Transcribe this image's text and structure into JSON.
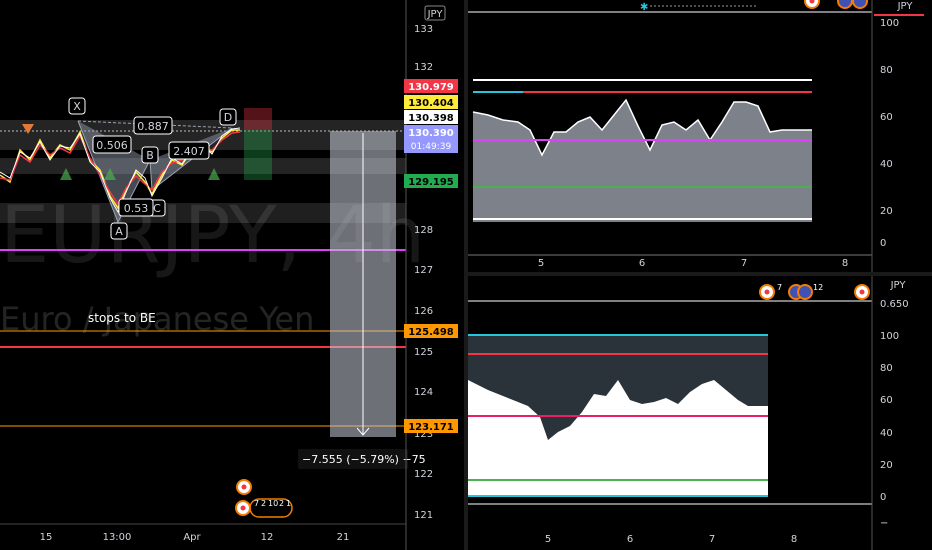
{
  "main_chart": {
    "currency": "JPY",
    "watermark_symbol": "EURJPY, 4h",
    "watermark_desc": "Euro / Japanese Yen",
    "annotation": "stops to BE",
    "measure_label": "−7.555 (−5.79%) −75",
    "pattern_points": [
      "X",
      "A",
      "B",
      "C",
      "D"
    ],
    "pattern_ratios": [
      "0.887",
      "0.506",
      "0.53",
      "2.407"
    ],
    "price_ticks": [
      "133",
      "132",
      "128",
      "127",
      "126",
      "125",
      "124",
      "123",
      "122",
      "121"
    ],
    "time_ticks": [
      "15",
      "13:00",
      "Apr",
      "12",
      "21"
    ],
    "price_badges": [
      {
        "label": "130.979",
        "color": "#f23645"
      },
      {
        "label": "130.404",
        "color": "#ffeb3b"
      },
      {
        "label": "130.398",
        "color": "#ffffff"
      },
      {
        "label": "130.390",
        "color": "#9598ff"
      },
      {
        "label": "01:49:39",
        "color": "#9598ff"
      },
      {
        "label": "129.195",
        "color": "#22ab4f"
      },
      {
        "label": "125.498",
        "color": "#ff9800"
      },
      {
        "label": "123.171",
        "color": "#ff9800"
      }
    ],
    "event_counts": [
      "7",
      "2",
      "10",
      "2",
      "1"
    ]
  },
  "osc_top": {
    "currency": "JPY",
    "y_ticks": [
      "100",
      "80",
      "60",
      "40",
      "20",
      "0"
    ],
    "x_ticks": [
      "5",
      "6",
      "7",
      "8"
    ]
  },
  "osc_bottom": {
    "currency": "JPY",
    "top_value": "0.650",
    "y_ticks": [
      "100",
      "80",
      "60",
      "40",
      "20",
      "0"
    ],
    "x_ticks": [
      "5",
      "6",
      "7",
      "8"
    ],
    "event_counts": [
      "7",
      "12"
    ]
  }
}
